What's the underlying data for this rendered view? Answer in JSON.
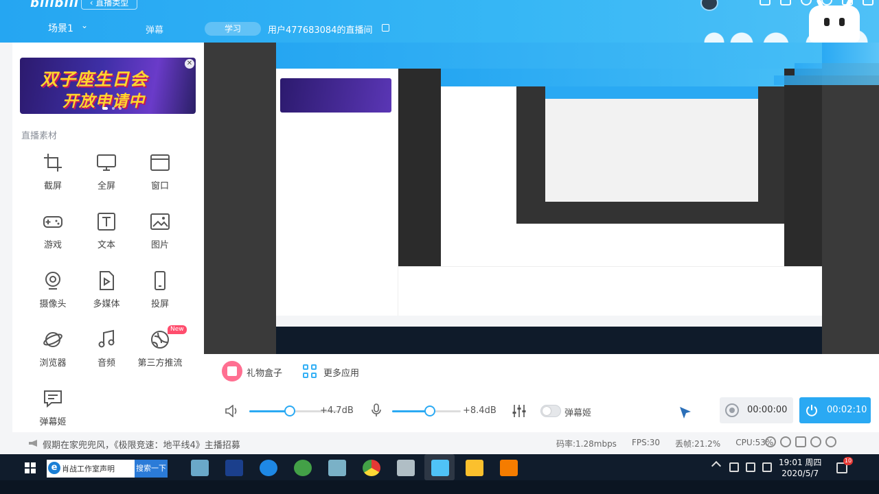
{
  "header": {
    "logo": "bilibili",
    "type_button": "‹ 直播类型",
    "scene_label": "场景1",
    "danmu_tab": "弹幕",
    "study_tag": "学习",
    "room_title": "用户477683084的直播间"
  },
  "sidebar": {
    "banner": {
      "line1": "双子座生日会",
      "line2": "开放申请中"
    },
    "section_label": "直播素材",
    "items": [
      {
        "label": "截屏",
        "icon": "crop-icon"
      },
      {
        "label": "全屏",
        "icon": "monitor-icon"
      },
      {
        "label": "窗口",
        "icon": "window-icon"
      },
      {
        "label": "游戏",
        "icon": "gamepad-icon"
      },
      {
        "label": "文本",
        "icon": "text-icon"
      },
      {
        "label": "图片",
        "icon": "image-icon"
      },
      {
        "label": "摄像头",
        "icon": "camera-icon"
      },
      {
        "label": "多媒体",
        "icon": "media-icon"
      },
      {
        "label": "投屏",
        "icon": "phone-icon"
      },
      {
        "label": "浏览器",
        "icon": "planet-icon"
      },
      {
        "label": "音频",
        "icon": "music-icon"
      },
      {
        "label": "第三方推流",
        "icon": "stream-icon",
        "badge": "New"
      },
      {
        "label": "弹幕姬",
        "icon": "danmu-icon"
      }
    ]
  },
  "controls": {
    "gift_label": "礼物盒子",
    "apps_label": "更多应用",
    "speaker_db": "+4.7dB",
    "mic_db": "+8.4dB",
    "speaker_level": 0.45,
    "mic_level": 0.55,
    "danmu_toggle_label": "弹幕姬",
    "record_time": "00:00:00",
    "live_time": "00:02:10"
  },
  "status": {
    "notice": "假期在家兜兜风，《极限竞速：地平线4》主播招募",
    "bitrate": "码率:1.28mbps",
    "fps": "FPS:30",
    "drop": "丢帧:21.2%",
    "cpu": "CPU:53%"
  },
  "taskbar": {
    "search_text": "肖战工作室声明",
    "search_button": "搜索一下",
    "time": "19:01 周四",
    "date": "2020/5/7",
    "notif_count": "10"
  },
  "colors": {
    "accent": "#2aa9f3",
    "badge": "#ff4d6d"
  }
}
